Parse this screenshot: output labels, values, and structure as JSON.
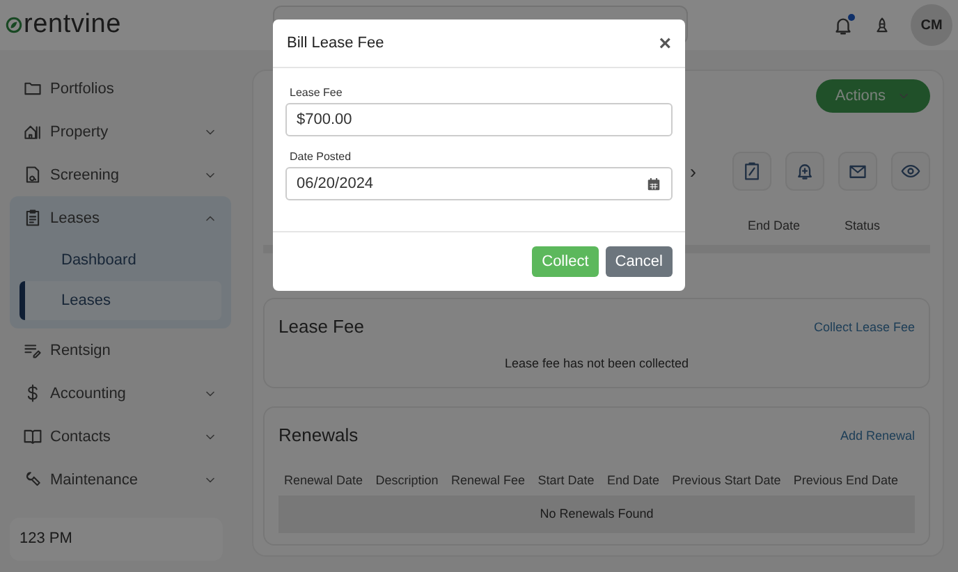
{
  "header": {
    "logo": "rentvine",
    "notification_dot": true,
    "avatar": "CM"
  },
  "sidebar": {
    "items": [
      {
        "label": "Portfolios",
        "kind": "link"
      },
      {
        "label": "Property",
        "kind": "group",
        "expanded": false
      },
      {
        "label": "Screening",
        "kind": "group",
        "expanded": false
      },
      {
        "label": "Leases",
        "kind": "group",
        "expanded": true,
        "children": [
          {
            "label": "Dashboard",
            "selected": false
          },
          {
            "label": "Leases",
            "selected": true
          }
        ]
      },
      {
        "label": "Rentsign",
        "kind": "link"
      },
      {
        "label": "Accounting",
        "kind": "group",
        "expanded": false
      },
      {
        "label": "Contacts",
        "kind": "group",
        "expanded": false
      },
      {
        "label": "Maintenance",
        "kind": "group",
        "expanded": false
      }
    ],
    "footer": "123 PM"
  },
  "lease_panel": {
    "actions_button": "Actions",
    "next_arrow": "›",
    "table": {
      "columns": [
        "End Date",
        "Status"
      ]
    }
  },
  "lease_fee": {
    "title": "Lease Fee",
    "link": "Collect Lease Fee",
    "message": "Lease fee has not been collected"
  },
  "renewals": {
    "title": "Renewals",
    "link": "Add Renewal",
    "table": {
      "columns": [
        "Renewal Date",
        "Description",
        "Renewal Fee",
        "Start Date",
        "End Date",
        "Previous Start Date",
        "Previous End Date"
      ],
      "empty_message": "No Renewals Found"
    }
  },
  "modal": {
    "title": "Bill Lease Fee",
    "close": "×",
    "fields": [
      {
        "label": "Lease Fee",
        "value": "$700.00",
        "kind": "text"
      },
      {
        "label": "Date Posted",
        "value": "06/20/2024",
        "kind": "date"
      }
    ],
    "buttons": [
      {
        "label": "Collect",
        "kind": "primary"
      },
      {
        "label": "Cancel",
        "kind": "secondary"
      }
    ]
  }
}
